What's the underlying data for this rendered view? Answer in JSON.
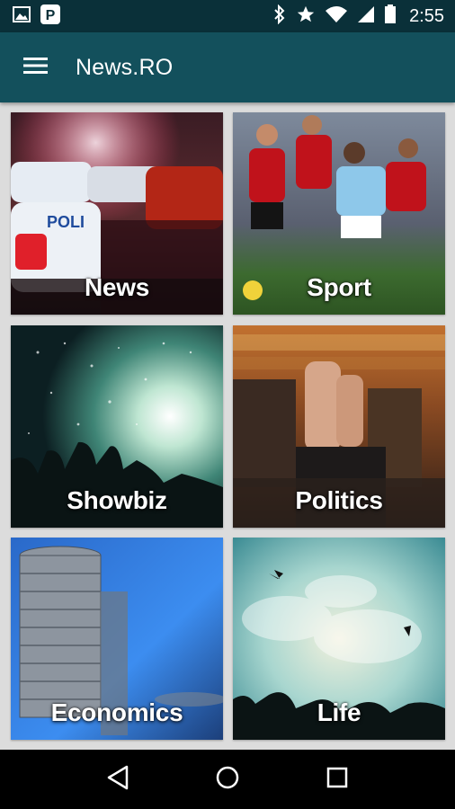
{
  "status_bar": {
    "time": "2:55",
    "left_icons": [
      "image-icon",
      "pinterest-icon"
    ],
    "right_icons": [
      "bluetooth-icon",
      "star-icon",
      "wifi-icon",
      "signal-icon",
      "battery-icon"
    ]
  },
  "app_bar": {
    "title": "News.RO",
    "menu_icon": "hamburger-menu-icon"
  },
  "categories": [
    {
      "label": "News",
      "image": "police-cars-times-square"
    },
    {
      "label": "Sport",
      "image": "football-players"
    },
    {
      "label": "Showbiz",
      "image": "concert-crowd"
    },
    {
      "label": "Politics",
      "image": "parliament-vote"
    },
    {
      "label": "Economics",
      "image": "coin-stacks"
    },
    {
      "label": "Life",
      "image": "sky-birds-silhouettes"
    }
  ],
  "nav_bar": {
    "icons": [
      "back-icon",
      "home-icon",
      "recents-icon"
    ]
  },
  "colors": {
    "status_bar": "#0a3039",
    "app_bar": "#13505c",
    "grid_background": "#dcdcdc",
    "nav_bar": "#000000"
  }
}
